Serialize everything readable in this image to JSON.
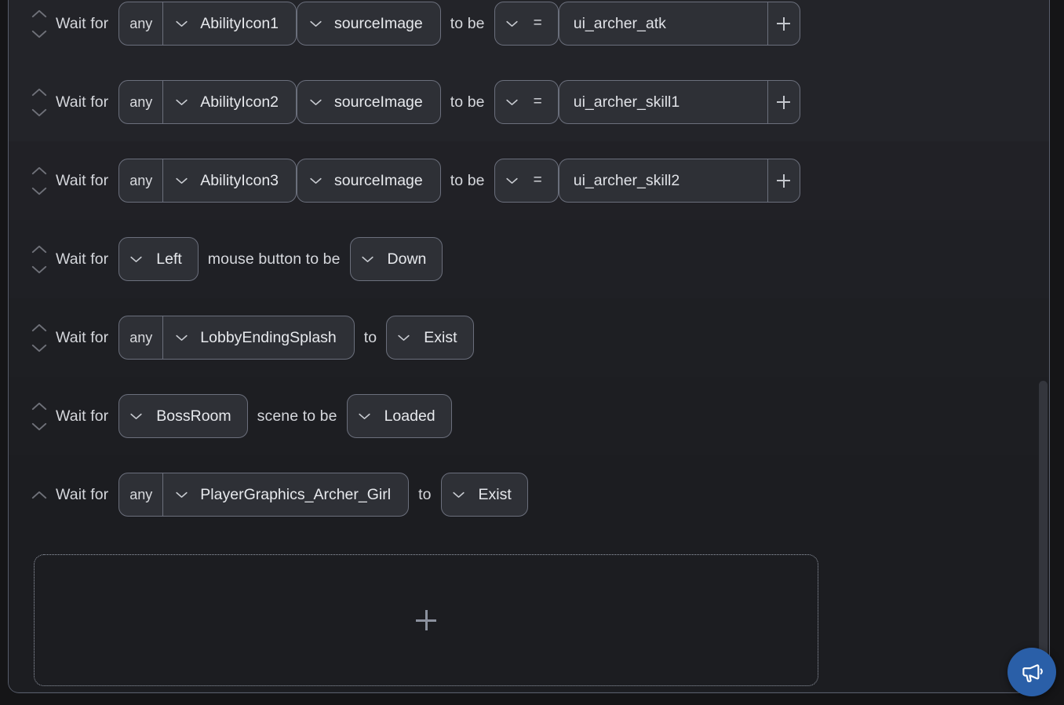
{
  "panel": {
    "name": "wait-conditions-list"
  },
  "labels": {
    "wait_for": "Wait for",
    "to_be": "to be",
    "to": "to",
    "mouse_button_to_be": "mouse button to be",
    "scene_to_be": "scene to be",
    "any": "any",
    "equals": "=",
    "plus": "+"
  },
  "rows": [
    {
      "type": "property",
      "lead": "Wait for",
      "scope": "any",
      "target": "AbilityIcon1",
      "property": "sourceImage",
      "connector": "to be",
      "operator": "=",
      "value": "ui_archer_atk",
      "has_add_button": true,
      "reorder_up": true,
      "reorder_down": true
    },
    {
      "type": "property",
      "lead": "Wait for",
      "scope": "any",
      "target": "AbilityIcon2",
      "property": "sourceImage",
      "connector": "to be",
      "operator": "=",
      "value": "ui_archer_skill1",
      "has_add_button": true,
      "reorder_up": true,
      "reorder_down": true
    },
    {
      "type": "property",
      "lead": "Wait for",
      "scope": "any",
      "target": "AbilityIcon3",
      "property": "sourceImage",
      "connector": "to be",
      "operator": "=",
      "value": "ui_archer_skill2",
      "has_add_button": true,
      "reorder_up": true,
      "reorder_down": true
    },
    {
      "type": "mouse",
      "lead": "Wait for",
      "button": "Left",
      "connector": "mouse button to be",
      "state": "Down",
      "reorder_up": true,
      "reorder_down": true
    },
    {
      "type": "exist",
      "lead": "Wait for",
      "scope": "any",
      "target": "LobbyEndingSplash",
      "connector": "to",
      "state": "Exist",
      "reorder_up": true,
      "reorder_down": true
    },
    {
      "type": "scene",
      "lead": "Wait for",
      "scene": "BossRoom",
      "connector": "scene to be",
      "state": "Loaded",
      "reorder_up": true,
      "reorder_down": true
    },
    {
      "type": "exist",
      "lead": "Wait for",
      "scope": "any",
      "target": "PlayerGraphics_Archer_Girl",
      "connector": "to",
      "state": "Exist",
      "reorder_up": true,
      "reorder_down": false
    }
  ],
  "add_zone": {
    "label": "+"
  },
  "announce_button": {
    "icon": "megaphone-icon"
  },
  "colors": {
    "page_background": "#151517",
    "panel_background": "#232429",
    "control_background": "#2e3036",
    "control_border": "#6b6f7c",
    "text_primary": "#e4e6ea",
    "text_secondary": "#d5d7dc",
    "accent_blue": "#2a5fa8",
    "scrollbar_thumb": "#34363d"
  }
}
